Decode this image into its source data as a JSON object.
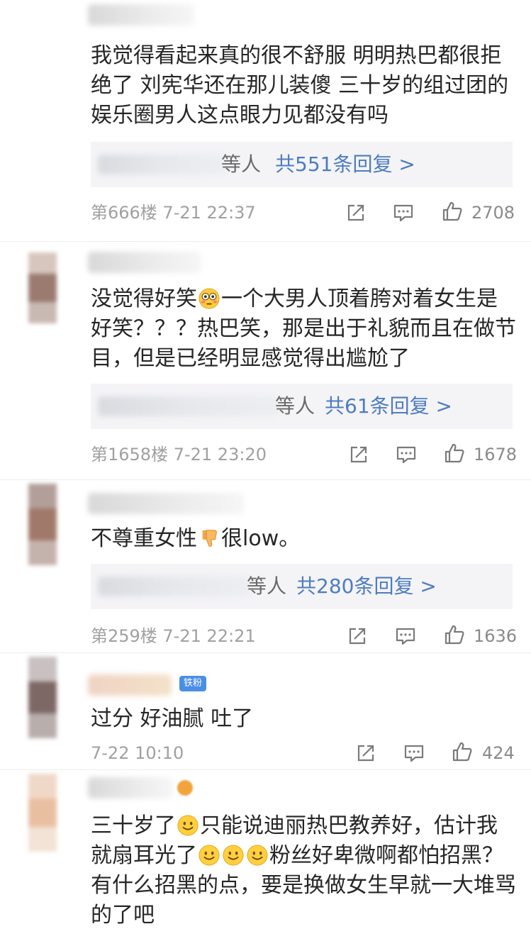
{
  "comments": [
    {
      "text": "我觉得看起来真的很不舒服 明明热巴都很拒绝了 刘宪华还在那儿装傻 三十岁的组过团的娱乐圈男人这点眼力见都没有吗",
      "reply_who": "等人",
      "reply_count": "共551条回复 >",
      "meta": "第666楼  7-21 22:37",
      "likes": "2708"
    },
    {
      "text_a": "没觉得好笑",
      "text_b": "一个大男人顶着胯对着女生是好笑？？？热巴笑，那是出于礼貌而且在做节目，但是已经明显感觉得出尴尬了",
      "reply_who": "等人",
      "reply_count": "共61条回复 >",
      "meta": "第1658楼  7-21 23:20",
      "likes": "1678"
    },
    {
      "text_a": "不尊重女性",
      "text_b": "很low。",
      "reply_who": "等人",
      "reply_count": "共280条回复 >",
      "meta": "第259楼  7-21 22:21",
      "likes": "1636"
    },
    {
      "badge": "铁粉",
      "text": "过分 好油腻 吐了",
      "meta": "7-22 10:10",
      "likes": "424"
    },
    {
      "text_a": "三十岁了",
      "text_b": "只能说迪丽热巴教养好，估计我就扇耳光了",
      "text_c": "粉丝好卑微啊都怕招黑？有什么招黑的点，要是换做女生早就一大堆骂的了吧"
    }
  ],
  "icons": {
    "share": "share-icon",
    "comment": "comment-icon",
    "like": "thumbs-up-icon",
    "emoji_flushed": "flushed-face-emoji",
    "emoji_thumbs_down": "thumbs-down-emoji",
    "emoji_smile": "slight-smile-emoji"
  },
  "colors": {
    "link": "#4d7cc2",
    "badge": "#4b8ee6",
    "meta": "#a0a0a0",
    "reply_bg": "#f4f4f6"
  }
}
